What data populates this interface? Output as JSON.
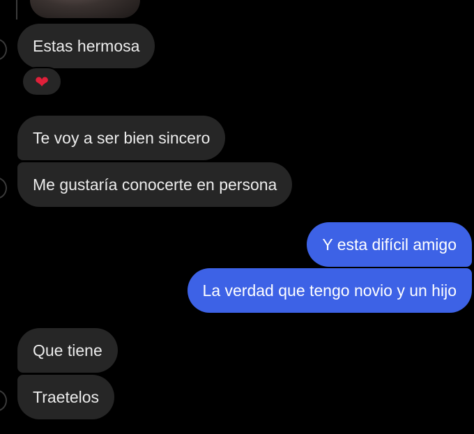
{
  "messages": [
    {
      "text": "Estas hermosa",
      "side": "incoming"
    },
    {
      "text": "Te voy a ser bien sincero",
      "side": "incoming"
    },
    {
      "text": "Me gustaría conocerte en persona",
      "side": "incoming"
    },
    {
      "text": "Y esta difícil amigo",
      "side": "outgoing"
    },
    {
      "text": "La verdad que tengo novio y un hijo",
      "side": "outgoing"
    },
    {
      "text": "Que tiene",
      "side": "incoming"
    },
    {
      "text": "Traetelos",
      "side": "incoming"
    }
  ],
  "reaction": {
    "emoji": "❤",
    "icon": "heart-icon"
  },
  "colors": {
    "background": "#000000",
    "incoming_bubble": "#262626",
    "outgoing_bubble": "#3d62e6",
    "reaction_heart": "#e0203a"
  }
}
